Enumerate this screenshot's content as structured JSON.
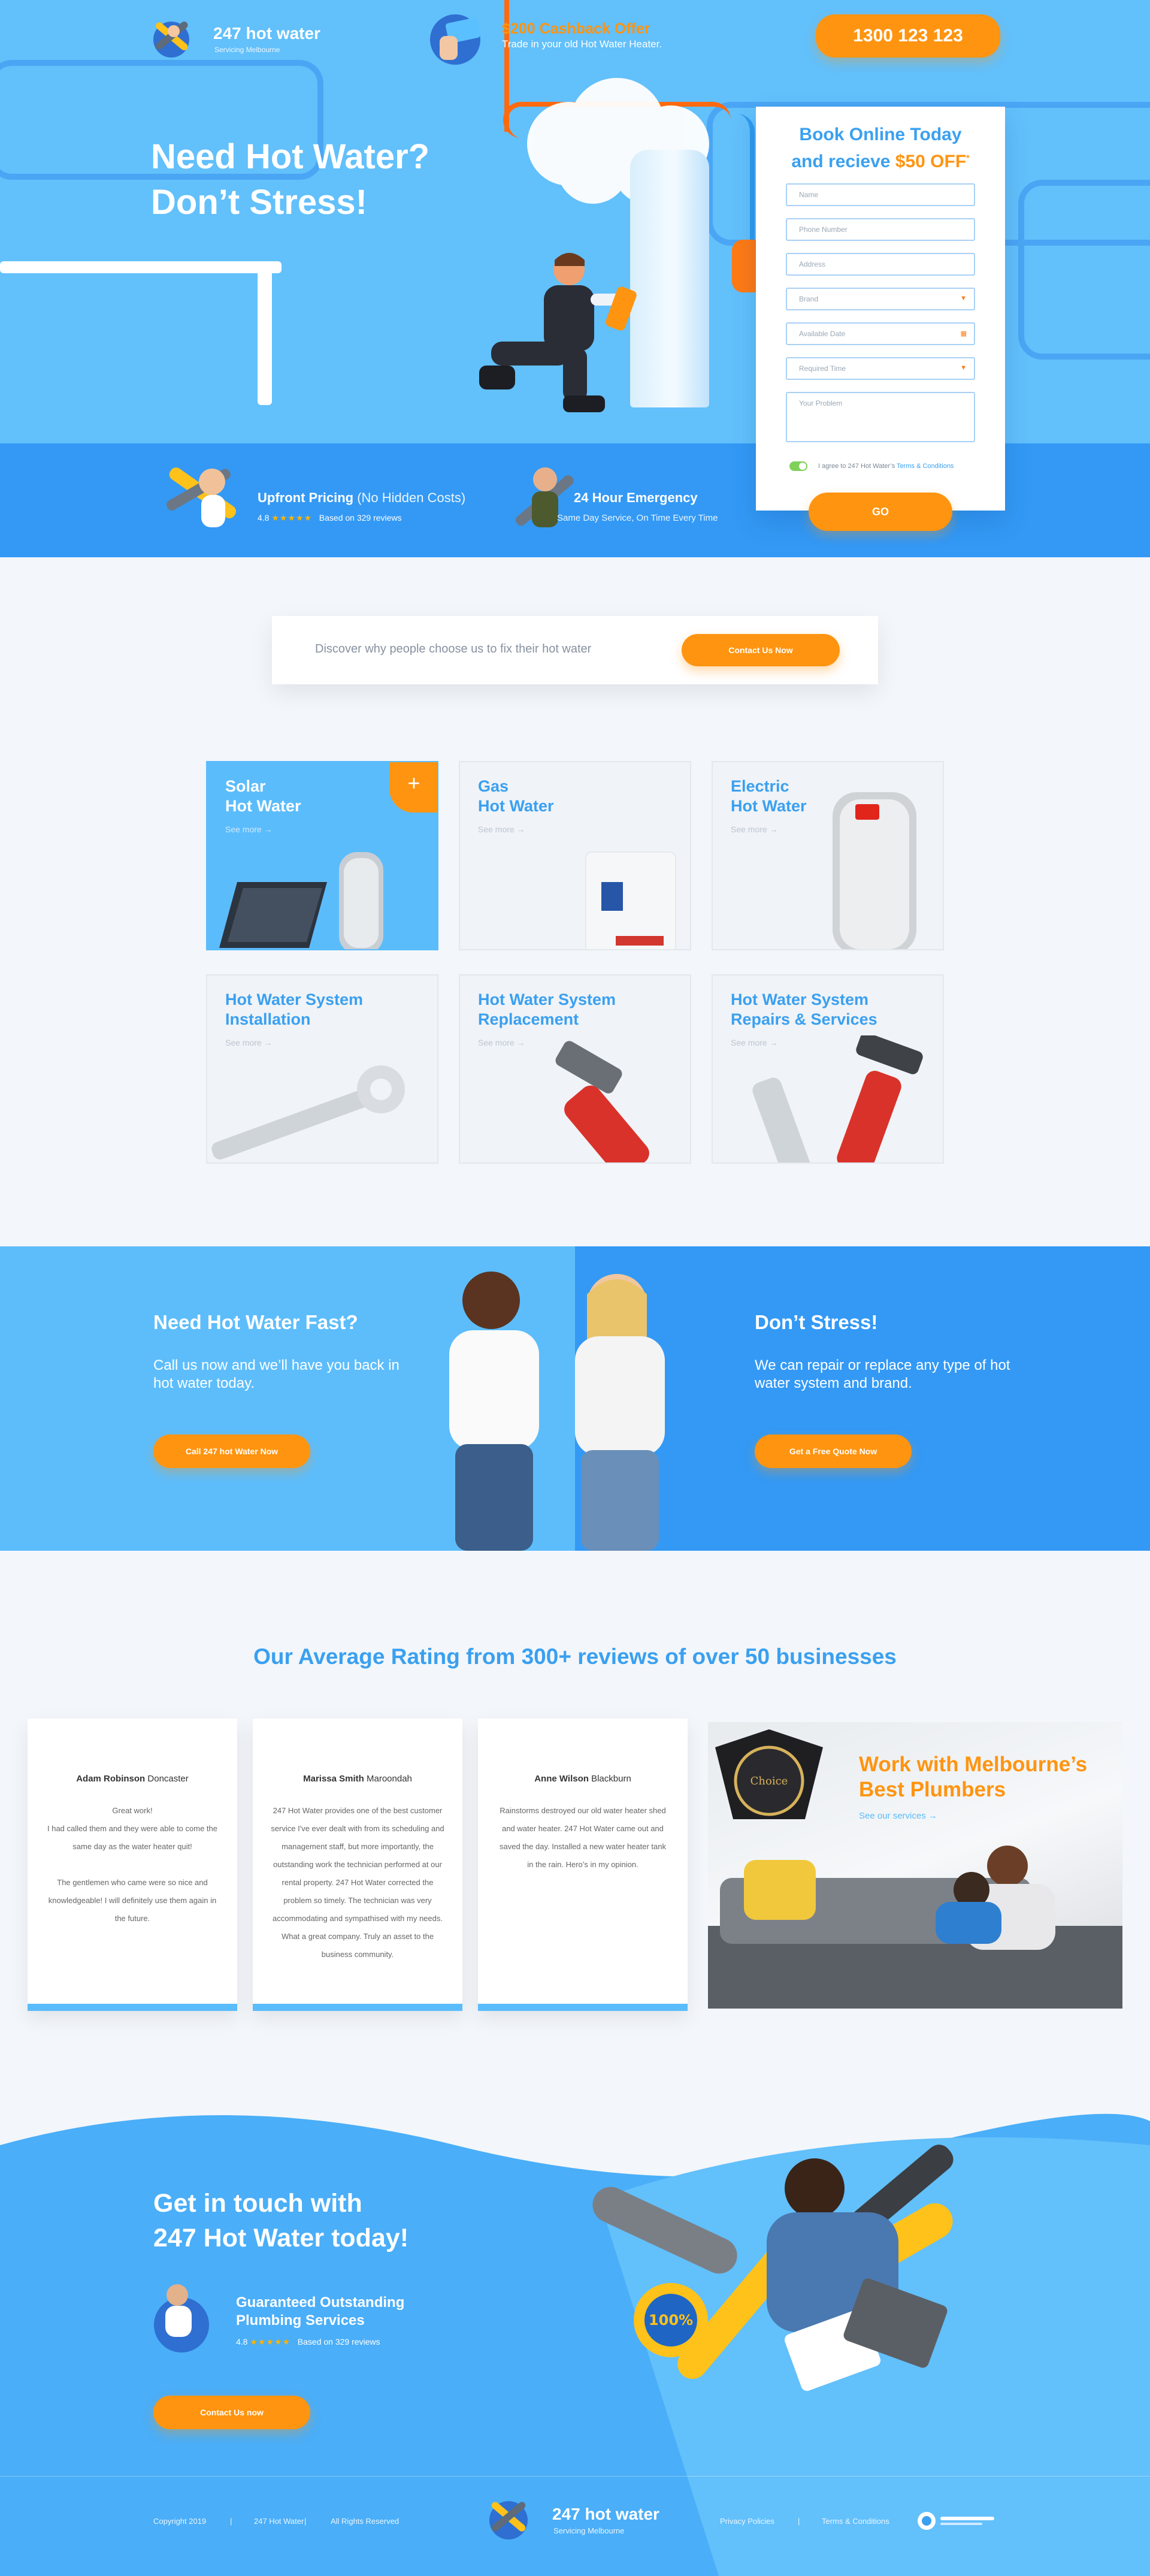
{
  "header": {
    "logo_name": "247 hot water",
    "logo_sub": "Servicing Melbourne",
    "offer_title": "$200 Cashback Offer",
    "offer_sub": "Trade in your old Hot Water Heater.",
    "phone": "1300 123 123"
  },
  "hero": {
    "title_line1": "Need Hot Water?",
    "title_line2": "Don’t Stress!"
  },
  "booking": {
    "title_line1": "Book Online Today",
    "title_line2_prefix": "and recieve ",
    "title_line2_offer": "$50 OFF",
    "title_line2_suffix": "*",
    "fields": {
      "name": "Name",
      "phone": "Phone Number",
      "address": "Address",
      "brand": "Brand",
      "date": "Available Date",
      "time": "Required Time",
      "problem": "Your Problem"
    },
    "agree_prefix": "I agree to 247 Hot Water’s ",
    "agree_link": "Terms & Conditions",
    "go_label": "GO"
  },
  "hero_features": {
    "f1_title": "Upfront Pricing",
    "f1_title_thin": " (No Hidden Costs)",
    "f1_rating": "4.8",
    "f1_stars": "★★★★★",
    "f1_reviews": "Based on 329 reviews",
    "f2_title": "24 Hour Emergency",
    "f2_sub": "Same Day Service, On Time Every Time"
  },
  "discover": {
    "text": "Discover why people choose us to fix their hot water",
    "button": "Contact Us Now"
  },
  "services": [
    {
      "line1": "Solar",
      "line2": "Hot Water",
      "more": "See more  →"
    },
    {
      "line1": "Gas",
      "line2": "Hot Water",
      "more": "See more  →"
    },
    {
      "line1": "Electric",
      "line2": "Hot Water",
      "more": "See more  →"
    },
    {
      "line1": "Hot Water System",
      "line2": "Installation",
      "more": "See more  →"
    },
    {
      "line1": "Hot Water System",
      "line2": "Replacement",
      "more": "See more  →"
    },
    {
      "line1": "Hot Water System",
      "line2": "Repairs & Services",
      "more": "See more  →"
    }
  ],
  "service_plus": "+",
  "split": {
    "left_title": "Need Hot Water Fast?",
    "left_text": "Call us now and we’ll have you back in hot water today.",
    "left_button": "Call 247 hot Water Now",
    "right_title": "Don’t Stress!",
    "right_text": "We can repair or replace any type of hot water system and brand.",
    "right_button": "Get a Free Quote Now"
  },
  "reviews": {
    "title": "Our Average Rating from 300+ reviews of over 50 businesses",
    "items": [
      {
        "name": "Adam Robinson",
        "suburb": "Doncaster",
        "text": "Great work!\nI had called them and they were able to come the same day as the water heater quit!\n\nThe gentlemen who came were so nice and knowledgeable! I will definitely use them again in the future."
      },
      {
        "name": "Marissa Smith",
        "suburb": "Maroondah",
        "text": "247 Hot Water provides one of the best customer service I've ever dealt with from its scheduling and management staff, but more importantly, the outstanding work the technician performed at our rental property. 247 Hot Water corrected the problem so timely. The technician was very accommodating and sympathised with my needs. What a great company. Truly an asset to the business community."
      },
      {
        "name": "Anne Wilson",
        "suburb": "Blackburn",
        "text": "Rainstorms destroyed our old water heater shed and water heater. 247 Hot Water came out and saved the day. Installed a new water heater tank in the rain. Hero’s in my opinion."
      }
    ],
    "plumbers_title_line1": "Work with Melbourne’s",
    "plumbers_title_line2": "Best Plumbers",
    "plumbers_more": "See our services  →"
  },
  "contact_band": {
    "title_line1": "Get in touch with",
    "title_line2": "247 Hot Water today!",
    "feat_line1": "Guaranteed Outstanding",
    "feat_line2": "Plumbing Services",
    "rating": "4.8",
    "stars": "★★★★★",
    "reviews": "Based on 329 reviews",
    "button": "Contact Us now"
  },
  "footer": {
    "copyright": "Copyright 2019",
    "brand": "247 Hot Water",
    "rights": "All Rights Reserved",
    "logo_name": "247 hot water",
    "logo_sub": "Servicing Melbourne",
    "privacy": "Privacy Policies",
    "terms": "Terms & Conditions",
    "separator": "|"
  },
  "colors": {
    "primary_blue": "#3aa0f0",
    "light_blue": "#62c0fb",
    "accent_orange": "#ff9410"
  }
}
